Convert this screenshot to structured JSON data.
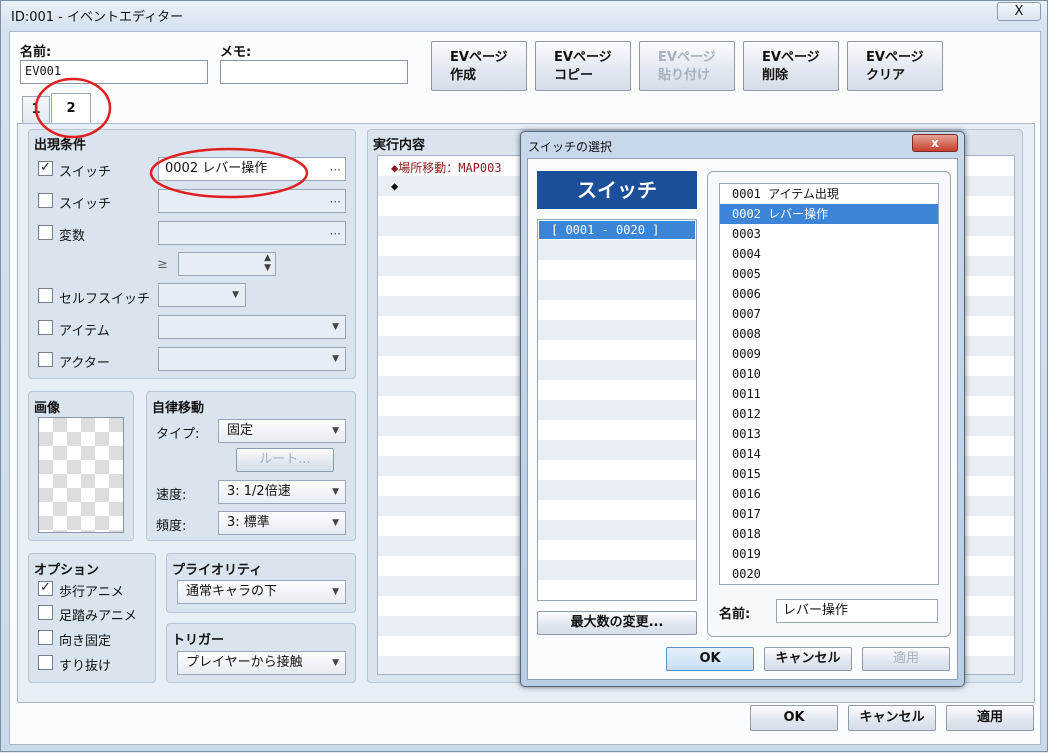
{
  "window": {
    "title": "ID:001 - イベントエディター",
    "close": "X"
  },
  "header": {
    "name_label": "名前:",
    "name_value": "EV001",
    "memo_label": "メモ:",
    "memo_value": "",
    "buttons": [
      {
        "line1": "EVページ",
        "line2": "作成"
      },
      {
        "line1": "EVページ",
        "line2": "コピー"
      },
      {
        "line1": "EVページ",
        "line2": "貼り付け"
      },
      {
        "line1": "EVページ",
        "line2": "削除"
      },
      {
        "line1": "EVページ",
        "line2": "クリア"
      }
    ]
  },
  "tabs": [
    "1",
    "2"
  ],
  "conditions": {
    "title": "出現条件",
    "switch1_label": "スイッチ",
    "switch1_value": "0002 レバー操作",
    "switch1_checked": "✓",
    "switch2_label": "スイッチ",
    "variable_label": "変数",
    "ge_symbol": "≥",
    "selfswitch_label": "セルフスイッチ",
    "item_label": "アイテム",
    "actor_label": "アクター",
    "dots": "···"
  },
  "image": {
    "title": "画像"
  },
  "autonomous": {
    "title": "自律移動",
    "type_label": "タイプ:",
    "type_value": "固定",
    "route_button": "ルート...",
    "speed_label": "速度:",
    "speed_value": "3: 1/2倍速",
    "freq_label": "頻度:",
    "freq_value": "3: 標準"
  },
  "options": {
    "title": "オプション",
    "items": [
      {
        "label": "歩行アニメ",
        "checked": "✓"
      },
      {
        "label": "足踏みアニメ",
        "checked": ""
      },
      {
        "label": "向き固定",
        "checked": ""
      },
      {
        "label": "すり抜け",
        "checked": ""
      }
    ]
  },
  "priority": {
    "title": "プライオリティ",
    "value": "通常キャラの下"
  },
  "trigger": {
    "title": "トリガー",
    "value": "プレイヤーから接触"
  },
  "contents": {
    "title": "実行内容",
    "line1": "◆場所移動：MAP003",
    "line2": "◆"
  },
  "dialog": {
    "title": "スイッチの選択",
    "close": "x",
    "category_header": "スイッチ",
    "groups": [
      "[ 0001 - 0020 ]"
    ],
    "max_button": "最大数の変更...",
    "items": [
      "0001 アイテム出現",
      "0002 レバー操作",
      "0003",
      "0004",
      "0005",
      "0006",
      "0007",
      "0008",
      "0009",
      "0010",
      "0011",
      "0012",
      "0013",
      "0014",
      "0015",
      "0016",
      "0017",
      "0018",
      "0019",
      "0020"
    ],
    "selected_index": 1,
    "name_label": "名前:",
    "name_value": "レバー操作",
    "ok": "OK",
    "cancel": "キャンセル",
    "apply": "適用"
  },
  "footer": {
    "ok": "OK",
    "cancel": "キャンセル",
    "apply": "適用"
  },
  "colors": {
    "highlight": "#3b84d8",
    "annotation": "#e02020",
    "cmd_text": "#8b1a1a"
  }
}
